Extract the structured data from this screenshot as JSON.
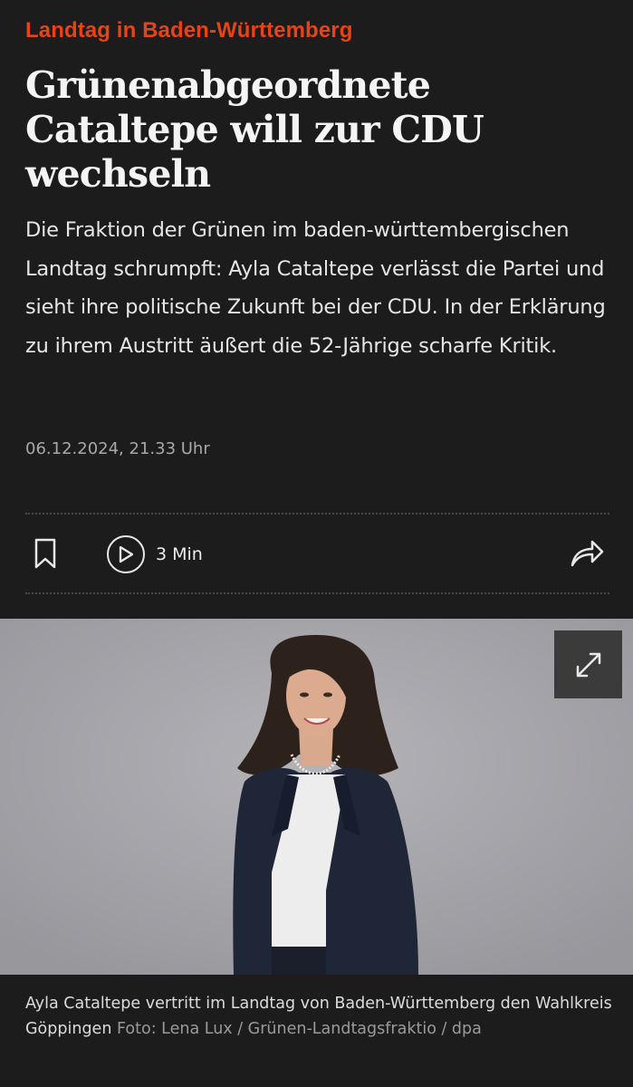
{
  "article": {
    "kicker": "Landtag in Baden-Württemberg",
    "headline": "Grünenabgeordnete Cataltepe will zur CDU wechseln",
    "teaser": "Die Fraktion der Grünen im baden-württembergischen Landtag schrumpft: Ayla Cataltepe verlässt die Partei und sieht ihre politische Zukunft bei der CDU. In der Erklärung zu ihrem Austritt äußert die 52-Jährige scharfe Kritik.",
    "date": "06.12.2024, 21.33 Uhr"
  },
  "toolbar": {
    "bookmark_icon": "bookmark-icon",
    "play_icon": "play-icon",
    "audio_duration": "3 Min",
    "share_icon": "share-icon"
  },
  "image": {
    "expand_icon": "expand-icon",
    "caption": "Ayla Cataltepe vertritt im Landtag von Baden-Württemberg den Wahlkreis Göppingen",
    "credit": "Foto: Lena Lux / Grünen-Landtagsfraktio / dpa"
  },
  "colors": {
    "background": "#1c1c1c",
    "kicker": "#e64415",
    "photo_background": "#a4a3a8"
  }
}
